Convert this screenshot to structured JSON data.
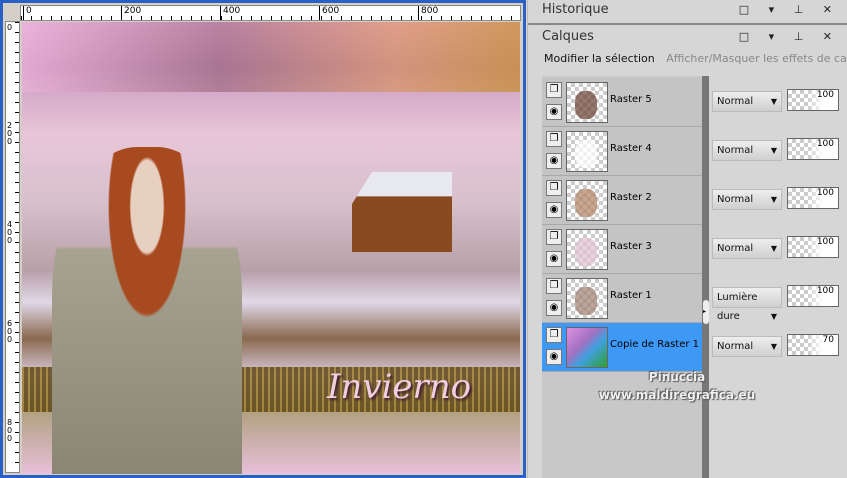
{
  "ruler": {
    "top_ticks": [
      "0",
      "200",
      "400",
      "600",
      "800"
    ],
    "left_ticks": [
      "0",
      "200",
      "400",
      "600",
      "800"
    ]
  },
  "artwork": {
    "title": "Invierno"
  },
  "panels": {
    "history": {
      "title": "Historique"
    },
    "layers": {
      "title": "Calques",
      "controls": "□ ▾ ⊥ ✕"
    },
    "history_controls": "□ ▾ ⊥ ✕"
  },
  "toolbar": {
    "modify_selection": "Modifier la sélection",
    "toggle_effects": "Afficher/Masquer les effets de calque"
  },
  "layers": [
    {
      "name": "Raster 5",
      "blend": "Normal",
      "opacity": "100",
      "selected": false,
      "thumb": "#6a4030"
    },
    {
      "name": "Raster 4",
      "blend": "Normal",
      "opacity": "100",
      "selected": false,
      "thumb": "#ffffff"
    },
    {
      "name": "Raster 2",
      "blend": "Normal",
      "opacity": "100",
      "selected": false,
      "thumb": "#b08060"
    },
    {
      "name": "Raster 3",
      "blend": "Normal",
      "opacity": "100",
      "selected": false,
      "thumb": "#e0c0d0"
    },
    {
      "name": "Raster 1",
      "blend": "Lumière dure",
      "opacity": "100",
      "selected": false,
      "thumb": "#a08070"
    },
    {
      "name": "Copie de Raster 1",
      "blend": "Normal",
      "opacity": "70",
      "selected": true,
      "thumb": "gradient"
    }
  ],
  "watermark": {
    "line1": "Pinuccia",
    "line2": "www.maldiregrafica.eu"
  },
  "colors": {
    "selection": "#3d99f5",
    "window_border": "#2a5fc8"
  }
}
